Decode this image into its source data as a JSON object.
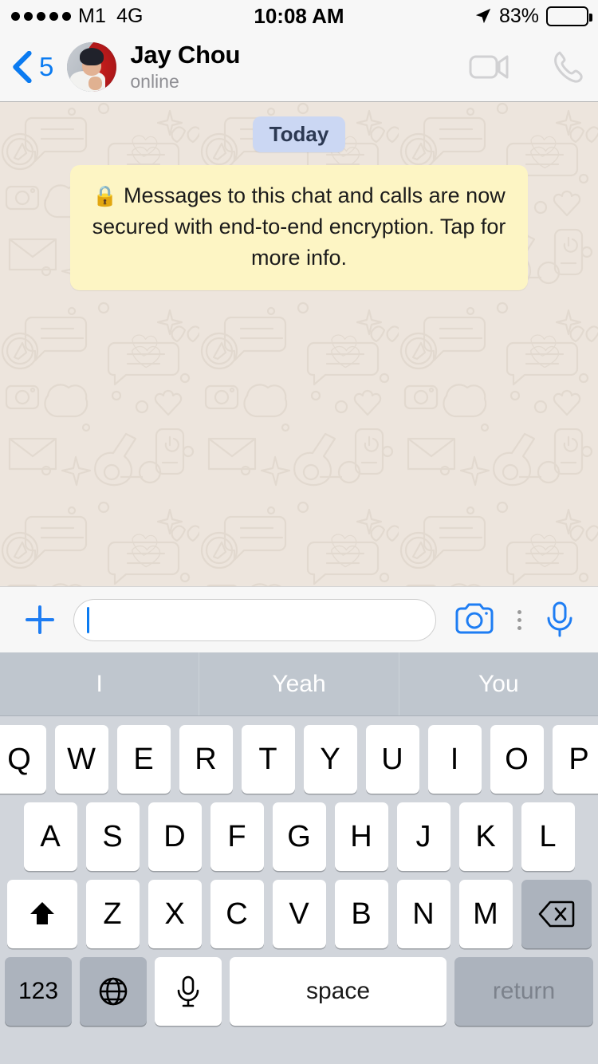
{
  "statusbar": {
    "carrier": "M1",
    "network": "4G",
    "time": "10:08 AM",
    "battery_percent": "83%",
    "battery_level": 83,
    "signal_dots": 5,
    "location_icon": "location-arrow-icon",
    "battery_color": "#FFCC00"
  },
  "navbar": {
    "back_icon": "chevron-left-icon",
    "back_count": "5",
    "contact_name": "Jay Chou",
    "contact_status": "online",
    "avatar_name": "contact-avatar",
    "video_call_icon": "video-camera-icon",
    "voice_call_icon": "phone-icon",
    "accent_color": "#0B7BF1"
  },
  "chat": {
    "day_divider": "Today",
    "day_pill_color": "#CBD7F3",
    "encryption_lock_icon": "lock-icon",
    "encryption_notice": "Messages to this chat and calls are now secured with end-to-end encryption. Tap for more info.",
    "encryption_bubble_color": "#FDF5C4",
    "wallpaper_color": "#EDE5DD"
  },
  "inputbar": {
    "attach_icon": "plus-icon",
    "message_value": "",
    "message_placeholder": "",
    "camera_icon": "camera-icon",
    "more_icon": "more-vertical-icon",
    "mic_icon": "microphone-icon"
  },
  "keyboard": {
    "suggestions": [
      "I",
      "Yeah",
      "You"
    ],
    "row1": [
      "Q",
      "W",
      "E",
      "R",
      "T",
      "Y",
      "U",
      "I",
      "O",
      "P"
    ],
    "row2": [
      "A",
      "S",
      "D",
      "F",
      "G",
      "H",
      "J",
      "K",
      "L"
    ],
    "row3": [
      "Z",
      "X",
      "C",
      "V",
      "B",
      "N",
      "M"
    ],
    "shift_icon": "shift-up-arrow-icon",
    "delete_icon": "backspace-delete-icon",
    "numeric_label": "123",
    "globe_icon": "globe-language-icon",
    "dictation_icon": "microphone-icon",
    "space_label": "space",
    "return_label": "return"
  }
}
